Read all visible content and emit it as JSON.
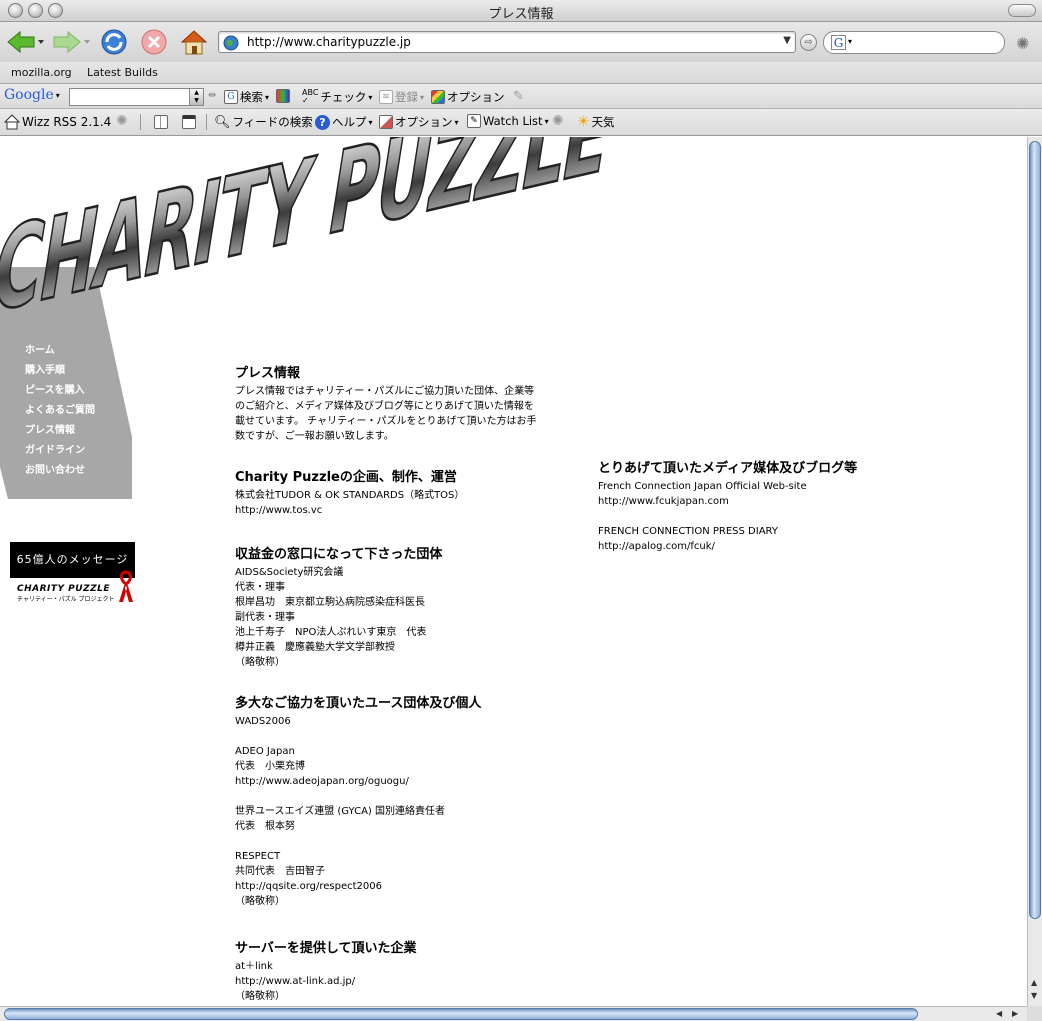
{
  "window": {
    "title": "プレス情報"
  },
  "nav": {
    "url": "http://www.charitypuzzle.jp",
    "search_value": ""
  },
  "bookmarks": [
    "mozilla.org",
    "Latest Builds"
  ],
  "google_toolbar": {
    "brand": "Google",
    "search_value": "",
    "search_label": "検索",
    "check_label": "チェック",
    "register_label": "登録",
    "options_label": "オプション"
  },
  "rss_toolbar": {
    "brand": "Wizz RSS 2.1.4",
    "feed_search": "フィードの検索",
    "help": "ヘルプ",
    "options": "オプション",
    "watch_list": "Watch List",
    "weather": "天気"
  },
  "site": {
    "logo_text": "CHARITY PUZZLE",
    "menu": [
      "ホーム",
      "購入手順",
      "ピースを購入",
      "よくあるご質問",
      "プレス情報",
      "ガイドライン",
      "お問い合わせ"
    ],
    "banner": {
      "message": "65億人のメッセージ",
      "brand": "CHARITY PUZZLE",
      "sub": "チャリティー・パズル プロジェクト"
    }
  },
  "press": {
    "title": "プレス情報",
    "intro": "プレス情報ではチャリティー・パズルにご協力頂いた団体、企業等のご紹介と、メディア媒体及びブログ等にとりあげて頂いた情報を載せています。 チャリティー・パズルをとりあげて頂いた方はお手数ですが、ご一報お願い致します。",
    "planning": {
      "heading": "Charity Puzzleの企画、制作、運営",
      "lines": [
        "株式会社TUDOR & OK STANDARDS（略式TOS）",
        "http://www.tos.vc"
      ]
    },
    "recipients": {
      "heading": "収益金の窓口になって下さった団体",
      "lines": [
        "AIDS&Society研究会議",
        "代表・理事",
        "根岸昌功　東京都立駒込病院感染症科医長",
        "副代表・理事",
        "池上千寿子　NPO法人ぷれいす東京　代表",
        "樽井正義　慶應義塾大学文学部教授",
        "（略敬称）"
      ]
    },
    "youth": {
      "heading": "多大なご協力を頂いたユース団体及び個人",
      "lines": [
        "WADS2006",
        "",
        "ADEO Japan",
        "代表　小栗充博",
        "http://www.adeojapan.org/oguogu/",
        "",
        "世界ユースエイズ連盟 (GYCA) 国別連絡責任者",
        "代表　根本努",
        "",
        "RESPECT",
        "共同代表　吉田智子",
        "http://qqsite.org/respect2006",
        "（略敬称）"
      ]
    },
    "server": {
      "heading": "サーバーを提供して頂いた企業",
      "lines": [
        "at＋link",
        "http://www.at-link.ad.jp/",
        "（略敬称）"
      ]
    },
    "media": {
      "heading": "とりあげて頂いたメディア媒体及びブログ等",
      "lines": [
        "French Connection Japan Official Web-site",
        "http://www.fcukjapan.com",
        "",
        "FRENCH CONNECTION PRESS DIARY",
        "http://apalog.com/fcuk/"
      ]
    }
  }
}
